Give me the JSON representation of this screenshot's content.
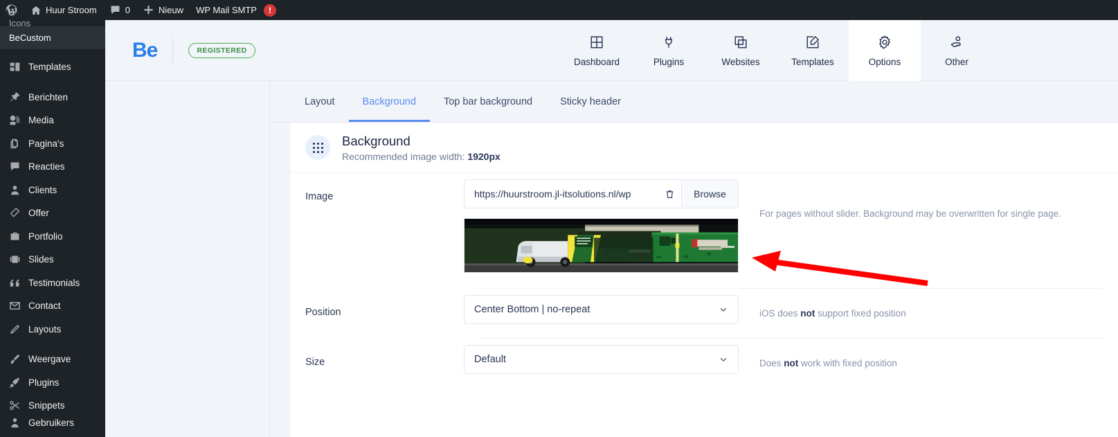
{
  "adminbar": {
    "items": [
      {
        "name": "wp-logo",
        "label": "",
        "icon": "wordpress-icon"
      },
      {
        "name": "site-name",
        "label": "Huur Stroom",
        "icon": "home-icon"
      },
      {
        "name": "comments",
        "label": "0",
        "icon": "comment-icon"
      },
      {
        "name": "new-content",
        "label": "Nieuw",
        "icon": "plus-icon"
      },
      {
        "name": "wp-mail-smtp",
        "label": "WP Mail SMTP",
        "icon": "alert-icon"
      }
    ],
    "alert_glyph": "!"
  },
  "sidebar": {
    "partial_top_label": "Icons",
    "current_label": "BeCustom",
    "items": [
      {
        "label": "Templates",
        "icon": "templates-icon"
      },
      {
        "label": "Berichten",
        "icon": "pin-icon"
      },
      {
        "label": "Media",
        "icon": "media-icon"
      },
      {
        "label": "Pagina's",
        "icon": "pages-icon"
      },
      {
        "label": "Reacties",
        "icon": "comment-icon"
      },
      {
        "label": "Clients",
        "icon": "user-icon"
      },
      {
        "label": "Offer",
        "icon": "layers-icon"
      },
      {
        "label": "Portfolio",
        "icon": "portfolio-icon"
      },
      {
        "label": "Slides",
        "icon": "slides-icon"
      },
      {
        "label": "Testimonials",
        "icon": "quote-icon"
      },
      {
        "label": "Contact",
        "icon": "envelope-icon"
      },
      {
        "label": "Layouts",
        "icon": "pencil-icon"
      },
      {
        "label": "Weergave",
        "icon": "brush-icon"
      },
      {
        "label": "Plugins",
        "icon": "plug-icon"
      },
      {
        "label": "Snippets",
        "icon": "scissors-icon"
      },
      {
        "label": "Gebruikers",
        "icon": "users-icon"
      }
    ]
  },
  "plugin_header": {
    "logo_text": "Be",
    "license_badge": "REGISTERED",
    "tabs": [
      {
        "label": "Dashboard",
        "icon": "grid-icon",
        "active": false
      },
      {
        "label": "Plugins",
        "icon": "plug-icon",
        "active": false
      },
      {
        "label": "Websites",
        "icon": "copy-icon",
        "active": false
      },
      {
        "label": "Templates",
        "icon": "edit-square-icon",
        "active": false
      },
      {
        "label": "Options",
        "icon": "gear-icon",
        "active": true
      },
      {
        "label": "Other",
        "icon": "hand-person-icon",
        "active": false
      }
    ]
  },
  "subtabs": [
    {
      "label": "Layout",
      "active": false
    },
    {
      "label": "Background",
      "active": true
    },
    {
      "label": "Top bar background",
      "active": false
    },
    {
      "label": "Sticky header",
      "active": false
    }
  ],
  "card": {
    "title": "Background",
    "subtitle_prefix": "Recommended image width: ",
    "subtitle_value": "1920px",
    "rows": {
      "image": {
        "label": "Image",
        "value": "https://huurstroom.jl-itsolutions.nl/wp",
        "placeholder": "",
        "delete_icon": "trash-icon",
        "browse_label": "Browse",
        "thumbnail_alt": "night photo of white van with green equipment and green generator unit in front of a hedge",
        "help_text": "For pages without slider. Background may be overwritten for single page."
      },
      "position": {
        "label": "Position",
        "value": "Center Bottom | no-repeat",
        "help_prefix": "iOS does ",
        "help_bold": "not",
        "help_suffix": " support fixed position"
      },
      "size": {
        "label": "Size",
        "value": "Default",
        "help_prefix": "Does ",
        "help_bold": "not",
        "help_suffix": " work with fixed position"
      }
    }
  },
  "annotation": {
    "type": "arrow",
    "color": "#fe0000",
    "points_to": "background image thumbnail"
  },
  "colors": {
    "admin_dark": "#1d2327",
    "page_bg": "#f1f4f8",
    "accent_blue": "#5b8def",
    "logo_blue": "#2a7fe8",
    "badge_green": "#4caf50",
    "annotation_red": "#fe0000"
  }
}
